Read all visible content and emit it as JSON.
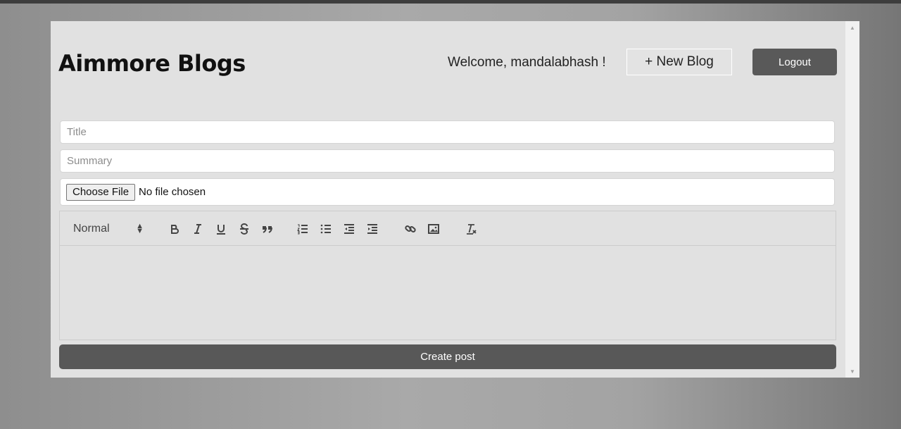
{
  "header": {
    "brand": "Aimmore Blogs",
    "welcome": "Welcome, mandalabhash !",
    "new_blog_label": "+ New Blog",
    "logout_label": "Logout"
  },
  "form": {
    "title_placeholder": "Title",
    "summary_placeholder": "Summary",
    "choose_file_label": "Choose File",
    "file_status": "No file chosen",
    "create_label": "Create post"
  },
  "editor": {
    "header_select_value": "Normal",
    "toolbar_icons": [
      "bold-icon",
      "italic-icon",
      "underline-icon",
      "strike-icon",
      "blockquote-icon",
      "ordered-list-icon",
      "bullet-list-icon",
      "outdent-icon",
      "indent-icon",
      "link-icon",
      "image-icon",
      "clear-format-icon"
    ]
  },
  "colors": {
    "card_bg": "#e1e1e1",
    "button_dark": "#595959"
  }
}
